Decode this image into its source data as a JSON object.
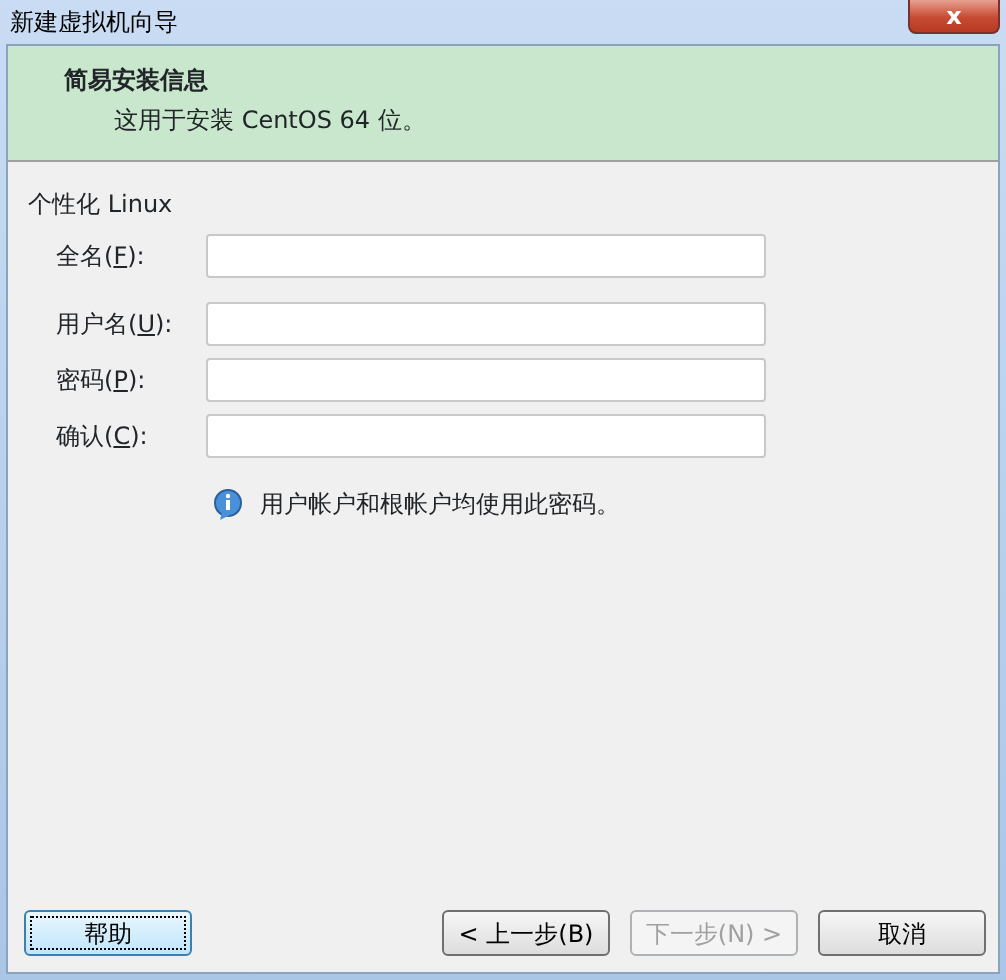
{
  "window": {
    "title": "新建虚拟机向导",
    "close_label": "x"
  },
  "header": {
    "title": "简易安装信息",
    "subtitle": "这用于安装 CentOS 64 位。"
  },
  "section": {
    "label": "个性化 Linux"
  },
  "field_groups": [
    [
      {
        "label_parts": [
          "全名(",
          "F",
          "):"
        ]
      }
    ],
    [
      {
        "label_parts": [
          "用户名(",
          "U",
          "):"
        ]
      },
      {
        "label_parts": [
          "密码(",
          "P",
          "):"
        ]
      },
      {
        "label_parts": [
          "确认(",
          "C",
          "):"
        ]
      }
    ]
  ],
  "info": "用户帐户和根帐户均使用此密码。",
  "left_buttons": [
    {
      "label": "帮助",
      "disabled": false,
      "focused": true
    }
  ],
  "right_buttons": [
    {
      "label": "< 上一步(B)",
      "disabled": false,
      "focused": false
    },
    {
      "label": "下一步(N) >",
      "disabled": true,
      "focused": false
    },
    {
      "label": "取消",
      "disabled": false,
      "focused": false
    }
  ]
}
